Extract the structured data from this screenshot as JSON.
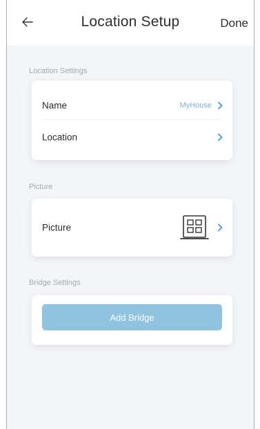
{
  "header": {
    "title": "Location Setup",
    "done_label": "Done",
    "back_icon": "arrow-left-icon"
  },
  "location_settings": {
    "section_label": "Location Settings",
    "name_label": "Name",
    "name_value": "MyHouse",
    "location_label": "Location"
  },
  "picture": {
    "section_label": "Picture",
    "picture_label": "Picture",
    "picture_icon": "building-icon"
  },
  "bridge_settings": {
    "section_label": "Bridge Settings",
    "add_bridge_label": "Add Bridge"
  },
  "colors": {
    "accent": "#7fb0dc",
    "button": "#8fc3df",
    "background": "#f4f5f8"
  }
}
